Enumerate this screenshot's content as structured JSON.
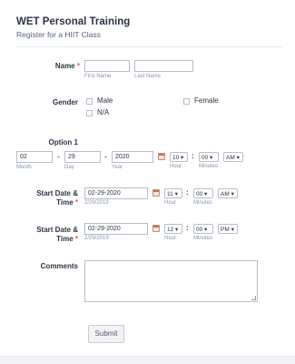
{
  "header": {
    "title": "WET Personal Training",
    "subtitle": "Register for a HIIT Class"
  },
  "name_field": {
    "label": "Name",
    "required_mark": "*",
    "first_sublabel": "First Name",
    "last_sublabel": "Last Name",
    "first_value": "",
    "last_value": ""
  },
  "gender_field": {
    "label": "Gender",
    "options": [
      "Male",
      "Female",
      "N/A"
    ]
  },
  "option1": {
    "label": "Option 1",
    "month": "02",
    "day": "29",
    "year": "2020",
    "month_sublabel": "Month",
    "day_sublabel": "Day",
    "year_sublabel": "Year",
    "separator": "-",
    "hour": "10",
    "minute": "00",
    "ampm": "AM",
    "hour_sublabel": "Hour",
    "minute_sublabel": "Minutes",
    "colon": ":"
  },
  "start1": {
    "label_line1": "Start Date &",
    "label_line2": "Time",
    "required_mark": "*",
    "date": "02-29-2020",
    "date_sublabel": "2/29/2019",
    "hour": "11",
    "minute": "00",
    "ampm": "AM",
    "hour_sublabel": "Hour",
    "minute_sublabel": "Minutes",
    "colon": ":"
  },
  "start2": {
    "label_line1": "Start Date &",
    "label_line2": "Time",
    "required_mark": "*",
    "date": "02-29-2020",
    "date_sublabel": "2/29/2019",
    "hour": "12",
    "minute": "00",
    "ampm": "PM",
    "hour_sublabel": "Hour",
    "minute_sublabel": "Minutes",
    "colon": ":"
  },
  "comments": {
    "label": "Comments",
    "value": ""
  },
  "submit": {
    "label": "Submit"
  },
  "icons": {
    "calendar": "calendar-icon",
    "dropdown": "chevron-down-icon"
  },
  "colors": {
    "required": "#e2574c",
    "calendar_accent": "#cc6f4b"
  }
}
